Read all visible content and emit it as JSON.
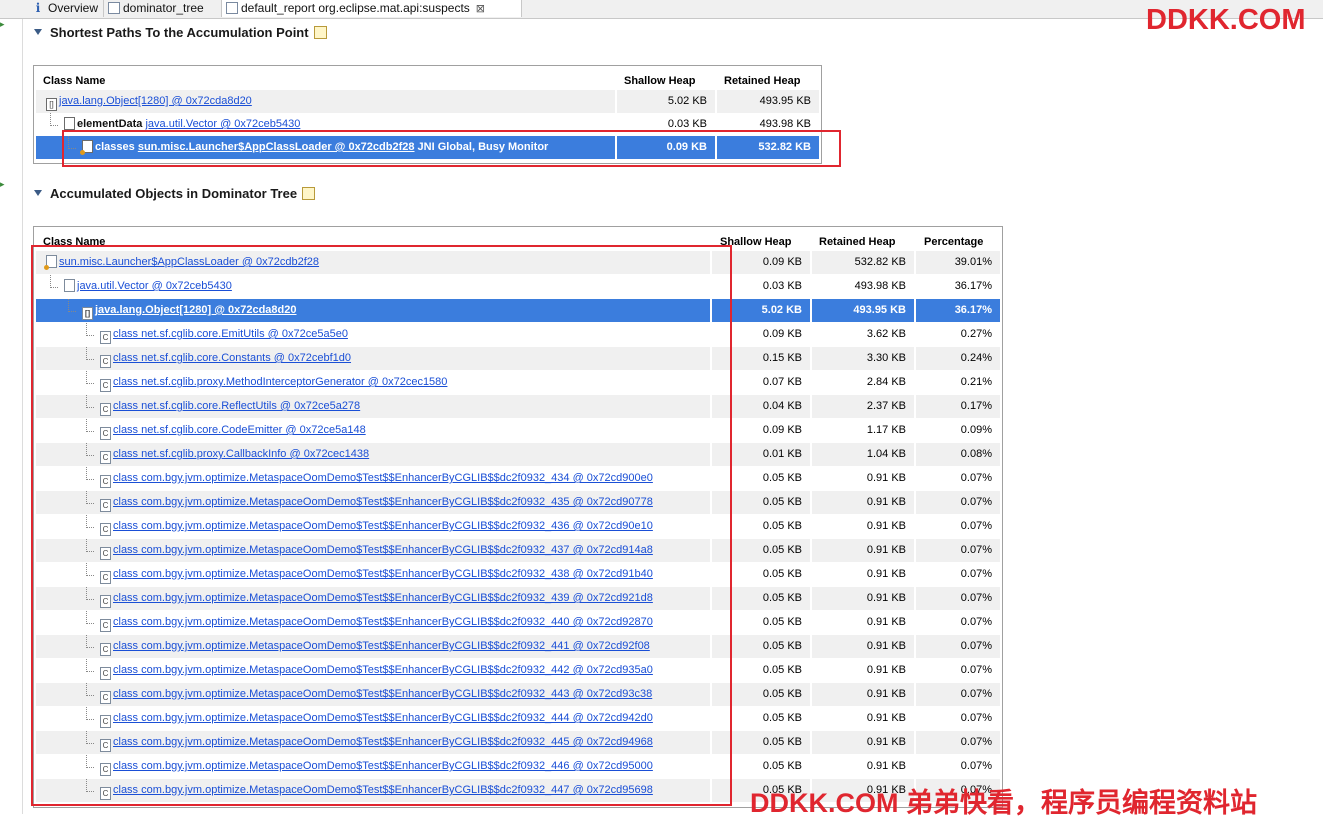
{
  "tabs": [
    {
      "label": "Overview",
      "icon": "info-icon"
    },
    {
      "label": "dominator_tree",
      "icon": "tree-icon"
    },
    {
      "label": "default_report  org.eclipse.mat.api:suspects",
      "icon": "report-icon",
      "active": true,
      "close": "⊠"
    }
  ],
  "watermark_top": "DDKK.COM",
  "watermark_bottom": "DDKK.COM 弟弟快看，程序员编程资料站",
  "section1": {
    "title": "Shortest Paths To the Accumulation Point",
    "columns": [
      "Class Name",
      "Shallow Heap",
      "Retained Heap"
    ],
    "rows": [
      {
        "prefix": "",
        "link": "java.lang.Object[1280] @ 0x72cda8d20",
        "suffix": "",
        "shallow": "5.02 KB",
        "retained": "493.95 KB"
      },
      {
        "prefix": "elementData ",
        "link": "java.util.Vector @ 0x72ceb5430",
        "suffix": "",
        "shallow": "0.03 KB",
        "retained": "493.98 KB"
      },
      {
        "prefix": "classes ",
        "link": "sun.misc.Launcher$AppClassLoader @ 0x72cdb2f28",
        "suffix": " JNI Global, Busy Monitor",
        "shallow": "0.09 KB",
        "retained": "532.82 KB"
      }
    ]
  },
  "section2": {
    "title": "Accumulated Objects in Dominator Tree",
    "columns": [
      "Class Name",
      "Shallow Heap",
      "Retained Heap",
      "Percentage"
    ],
    "rows": [
      {
        "name": "sun.misc.Launcher$AppClassLoader @ 0x72cdb2f28",
        "shallow": "0.09 KB",
        "retained": "532.82 KB",
        "pct": "39.01%"
      },
      {
        "name": "java.util.Vector @ 0x72ceb5430",
        "shallow": "0.03 KB",
        "retained": "493.98 KB",
        "pct": "36.17%"
      },
      {
        "name": "java.lang.Object[1280] @ 0x72cda8d20",
        "shallow": "5.02 KB",
        "retained": "493.95 KB",
        "pct": "36.17%"
      },
      {
        "name": "class net.sf.cglib.core.EmitUtils @ 0x72ce5a5e0",
        "shallow": "0.09 KB",
        "retained": "3.62 KB",
        "pct": "0.27%"
      },
      {
        "name": "class net.sf.cglib.core.Constants @ 0x72cebf1d0",
        "shallow": "0.15 KB",
        "retained": "3.30 KB",
        "pct": "0.24%"
      },
      {
        "name": "class net.sf.cglib.proxy.MethodInterceptorGenerator @ 0x72cec1580",
        "shallow": "0.07 KB",
        "retained": "2.84 KB",
        "pct": "0.21%"
      },
      {
        "name": "class net.sf.cglib.core.ReflectUtils @ 0x72ce5a278",
        "shallow": "0.04 KB",
        "retained": "2.37 KB",
        "pct": "0.17%"
      },
      {
        "name": "class net.sf.cglib.core.CodeEmitter @ 0x72ce5a148",
        "shallow": "0.09 KB",
        "retained": "1.17 KB",
        "pct": "0.09%"
      },
      {
        "name": "class net.sf.cglib.proxy.CallbackInfo @ 0x72cec1438",
        "shallow": "0.01 KB",
        "retained": "1.04 KB",
        "pct": "0.08%"
      },
      {
        "name": "class com.bgy.jvm.optimize.MetaspaceOomDemo$Test$$EnhancerByCGLIB$$dc2f0932_434 @ 0x72cd900e0",
        "shallow": "0.05 KB",
        "retained": "0.91 KB",
        "pct": "0.07%"
      },
      {
        "name": "class com.bgy.jvm.optimize.MetaspaceOomDemo$Test$$EnhancerByCGLIB$$dc2f0932_435 @ 0x72cd90778",
        "shallow": "0.05 KB",
        "retained": "0.91 KB",
        "pct": "0.07%"
      },
      {
        "name": "class com.bgy.jvm.optimize.MetaspaceOomDemo$Test$$EnhancerByCGLIB$$dc2f0932_436 @ 0x72cd90e10",
        "shallow": "0.05 KB",
        "retained": "0.91 KB",
        "pct": "0.07%"
      },
      {
        "name": "class com.bgy.jvm.optimize.MetaspaceOomDemo$Test$$EnhancerByCGLIB$$dc2f0932_437 @ 0x72cd914a8",
        "shallow": "0.05 KB",
        "retained": "0.91 KB",
        "pct": "0.07%"
      },
      {
        "name": "class com.bgy.jvm.optimize.MetaspaceOomDemo$Test$$EnhancerByCGLIB$$dc2f0932_438 @ 0x72cd91b40",
        "shallow": "0.05 KB",
        "retained": "0.91 KB",
        "pct": "0.07%"
      },
      {
        "name": "class com.bgy.jvm.optimize.MetaspaceOomDemo$Test$$EnhancerByCGLIB$$dc2f0932_439 @ 0x72cd921d8",
        "shallow": "0.05 KB",
        "retained": "0.91 KB",
        "pct": "0.07%"
      },
      {
        "name": "class com.bgy.jvm.optimize.MetaspaceOomDemo$Test$$EnhancerByCGLIB$$dc2f0932_440 @ 0x72cd92870",
        "shallow": "0.05 KB",
        "retained": "0.91 KB",
        "pct": "0.07%"
      },
      {
        "name": "class com.bgy.jvm.optimize.MetaspaceOomDemo$Test$$EnhancerByCGLIB$$dc2f0932_441 @ 0x72cd92f08",
        "shallow": "0.05 KB",
        "retained": "0.91 KB",
        "pct": "0.07%"
      },
      {
        "name": "class com.bgy.jvm.optimize.MetaspaceOomDemo$Test$$EnhancerByCGLIB$$dc2f0932_442 @ 0x72cd935a0",
        "shallow": "0.05 KB",
        "retained": "0.91 KB",
        "pct": "0.07%"
      },
      {
        "name": "class com.bgy.jvm.optimize.MetaspaceOomDemo$Test$$EnhancerByCGLIB$$dc2f0932_443 @ 0x72cd93c38",
        "shallow": "0.05 KB",
        "retained": "0.91 KB",
        "pct": "0.07%"
      },
      {
        "name": "class com.bgy.jvm.optimize.MetaspaceOomDemo$Test$$EnhancerByCGLIB$$dc2f0932_444 @ 0x72cd942d0",
        "shallow": "0.05 KB",
        "retained": "0.91 KB",
        "pct": "0.07%"
      },
      {
        "name": "class com.bgy.jvm.optimize.MetaspaceOomDemo$Test$$EnhancerByCGLIB$$dc2f0932_445 @ 0x72cd94968",
        "shallow": "0.05 KB",
        "retained": "0.91 KB",
        "pct": "0.07%"
      },
      {
        "name": "class com.bgy.jvm.optimize.MetaspaceOomDemo$Test$$EnhancerByCGLIB$$dc2f0932_446 @ 0x72cd95000",
        "shallow": "0.05 KB",
        "retained": "0.91 KB",
        "pct": "0.07%"
      },
      {
        "name": "class com.bgy.jvm.optimize.MetaspaceOomDemo$Test$$EnhancerByCGLIB$$dc2f0932_447 @ 0x72cd95698",
        "shallow": "0.05 KB",
        "retained": "0.91 KB",
        "pct": "0.07%"
      }
    ]
  },
  "colors": {
    "selection": "#3b7ddd",
    "link": "#1a4fd6",
    "highlight_box": "#e0262f"
  }
}
